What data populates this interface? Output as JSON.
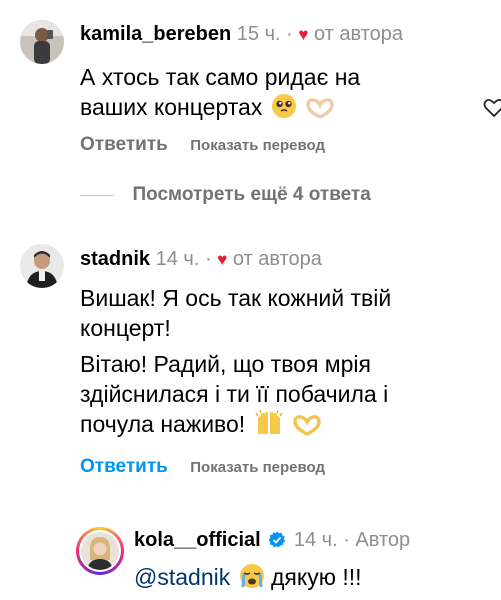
{
  "comments": [
    {
      "username": "kamila_bereben",
      "time": "15 ч.",
      "sep": "·",
      "author_liked": "от автора",
      "lines": [
        "А хтось так само ридає на",
        "ваших концертах"
      ],
      "line_emoji": [
        "crying-pleading-emoji",
        "heart-hands-emoji"
      ],
      "reply_label": "Ответить",
      "translate_label": "Показать перевод"
    },
    {
      "username": "stadnik",
      "time": "14 ч.",
      "sep": "·",
      "author_liked": "от автора",
      "lines": [
        "Вишак! Я ось так кожний твій",
        "концерт!",
        "Вітаю! Радий, що твоя мрія",
        "здійснилася і ти її побачила і",
        "почула наживо!"
      ],
      "line_emoji": [
        "raising-hands-emoji",
        "heart-hands-emoji"
      ],
      "reply_label": "Ответить",
      "translate_label": "Показать перевод"
    },
    {
      "username": "kola__official",
      "time": "14 ч.",
      "sep": "·",
      "author_label": "Автор",
      "mention": "@stadnik",
      "line_emoji": [
        "loudly-crying-emoji"
      ],
      "text_after": "дякую !!!"
    }
  ],
  "view_more_label": "Посмотреть ещё 4 ответа",
  "colors": {
    "username": "#000000",
    "meta": "#8e8e8e",
    "heart": "#ed1c34",
    "action_gray": "#737373",
    "action_blue": "#0095f6",
    "mention": "#00376b",
    "verified": "#0095f6"
  }
}
